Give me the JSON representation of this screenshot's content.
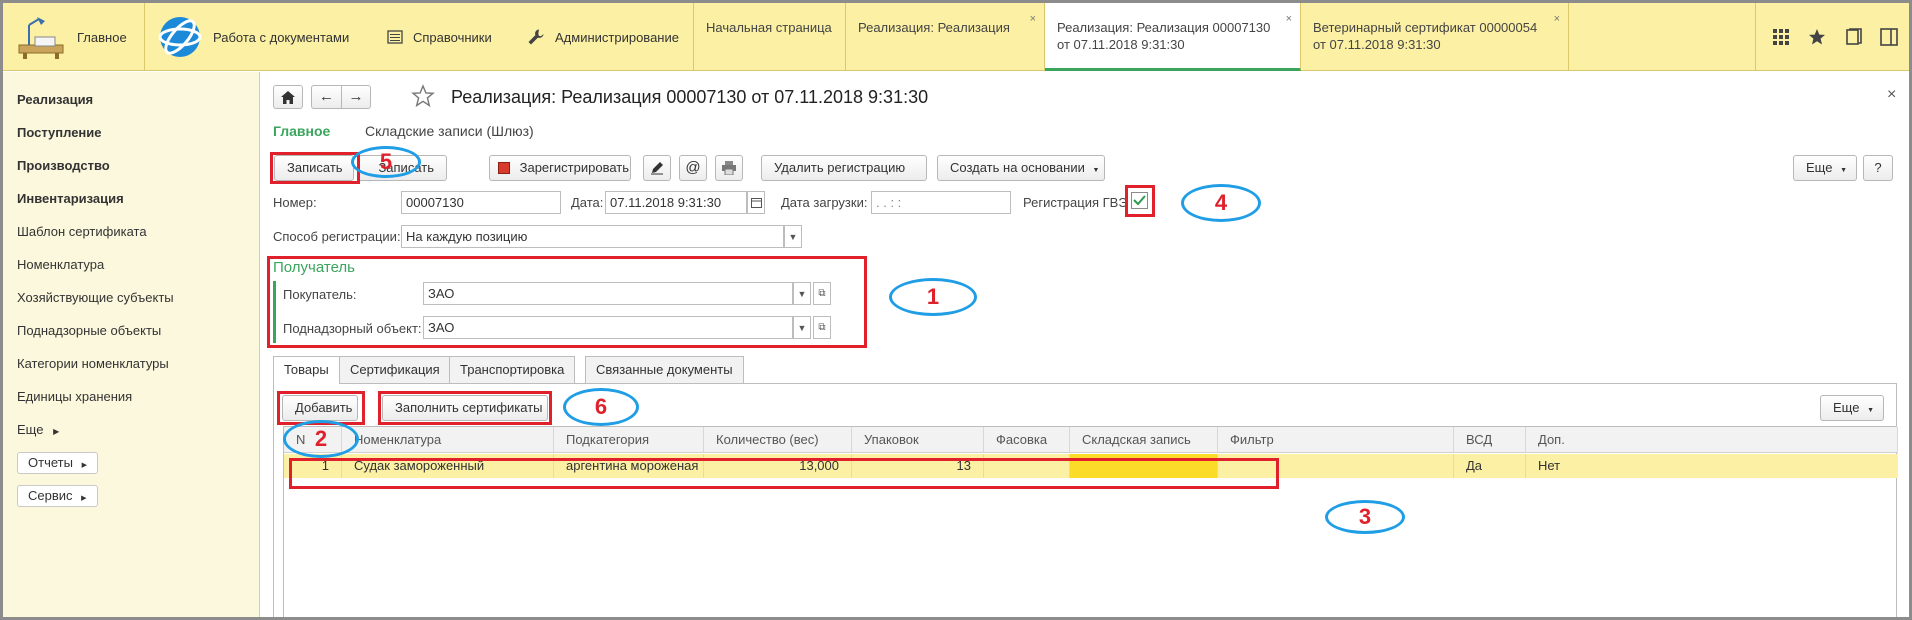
{
  "topbar": {
    "home_label": "Главное",
    "sections": [
      {
        "label": "Работа с документами"
      },
      {
        "label": "Справочники"
      },
      {
        "label": "Администрирование"
      }
    ],
    "tabs": [
      {
        "line1": "Начальная страница",
        "line2": ""
      },
      {
        "line1": "Реализация: Реализация",
        "line2": ""
      },
      {
        "line1": "Реализация: Реализация 00007130",
        "line2": "от 07.11.2018 9:31:30"
      },
      {
        "line1": "Ветеринарный сертификат 00000054",
        "line2": "от 07.11.2018 9:31:30"
      }
    ],
    "close_glyph": "×"
  },
  "sidebar": {
    "items": [
      {
        "label": "Реализация",
        "bold": true
      },
      {
        "label": "Поступление",
        "bold": true
      },
      {
        "label": "Производство",
        "bold": true
      },
      {
        "label": "Инвентаризация",
        "bold": true
      },
      {
        "label": "Шаблон сертификата",
        "bold": false
      },
      {
        "label": "Номенклатура",
        "bold": false
      },
      {
        "label": "Хозяйствующие субъекты",
        "bold": false
      },
      {
        "label": "Поднадзорные объекты",
        "bold": false
      },
      {
        "label": "Категории номенклатуры",
        "bold": false
      },
      {
        "label": "Единицы хранения",
        "bold": false
      },
      {
        "label": "Еще",
        "bold": false
      }
    ],
    "buttons": [
      {
        "label": "Отчеты"
      },
      {
        "label": "Сервис"
      }
    ]
  },
  "document": {
    "title": "Реализация: Реализация 00007130 от 07.11.2018 9:31:30",
    "close_glyph": "×",
    "sections": {
      "main": "Главное",
      "stock": "Складские записи (Шлюз)"
    },
    "toolbar": {
      "save": "Записать",
      "post_partial": "Записать",
      "register": "Зарегистрировать",
      "delete_registration": "Удалить регистрацию",
      "create_based": "Создать на основании",
      "more": "Еще",
      "help": "?"
    },
    "fields": {
      "number_label": "Номер:",
      "number_value": "00007130",
      "date_label": "Дата:",
      "date_value": "07.11.2018  9:31:30",
      "upload_label": "Дата загрузки:",
      "upload_value": "  .  .       :  :  ",
      "gvz_label": "Регистрация ГВЭ",
      "method_label": "Способ регистрации:",
      "method_value": "На каждую позицию"
    },
    "recipient": {
      "title": "Получатель",
      "buyer_label": "Покупатель:",
      "buyer_value": "ЗАО",
      "object_label": "Поднадзорный объект:",
      "object_value": "ЗАО"
    },
    "tabs": [
      "Товары",
      "Сертификация",
      "Транспортировка",
      "Связанные документы"
    ],
    "grid_toolbar": {
      "add": "Добавить",
      "fill": "Заполнить сертификаты",
      "more": "Еще"
    },
    "grid": {
      "columns": [
        "N",
        "Номенклатура",
        "Подкатегория",
        "Количество (вес)",
        "Упаковок",
        "Фасовка",
        "Складская запись",
        "Фильтр",
        "ВСД",
        "Доп."
      ],
      "rows": [
        [
          "1",
          "Судак замороженный",
          "аргентина мороженая",
          "13,000",
          "13",
          "",
          "",
          "",
          "Да",
          "Нет"
        ]
      ]
    }
  },
  "callouts": [
    "1",
    "2",
    "3",
    "4",
    "5",
    "6"
  ],
  "colors": {
    "topbar_bg": "#fbf0a3",
    "sidebar_bg": "#fcf8dd",
    "accent_green": "#3ba55d",
    "annotation_red": "#e0212b",
    "annotation_blue": "#1f9ee6",
    "row_selected": "#fbf0a3",
    "cell_highlight": "#fbdc28"
  }
}
